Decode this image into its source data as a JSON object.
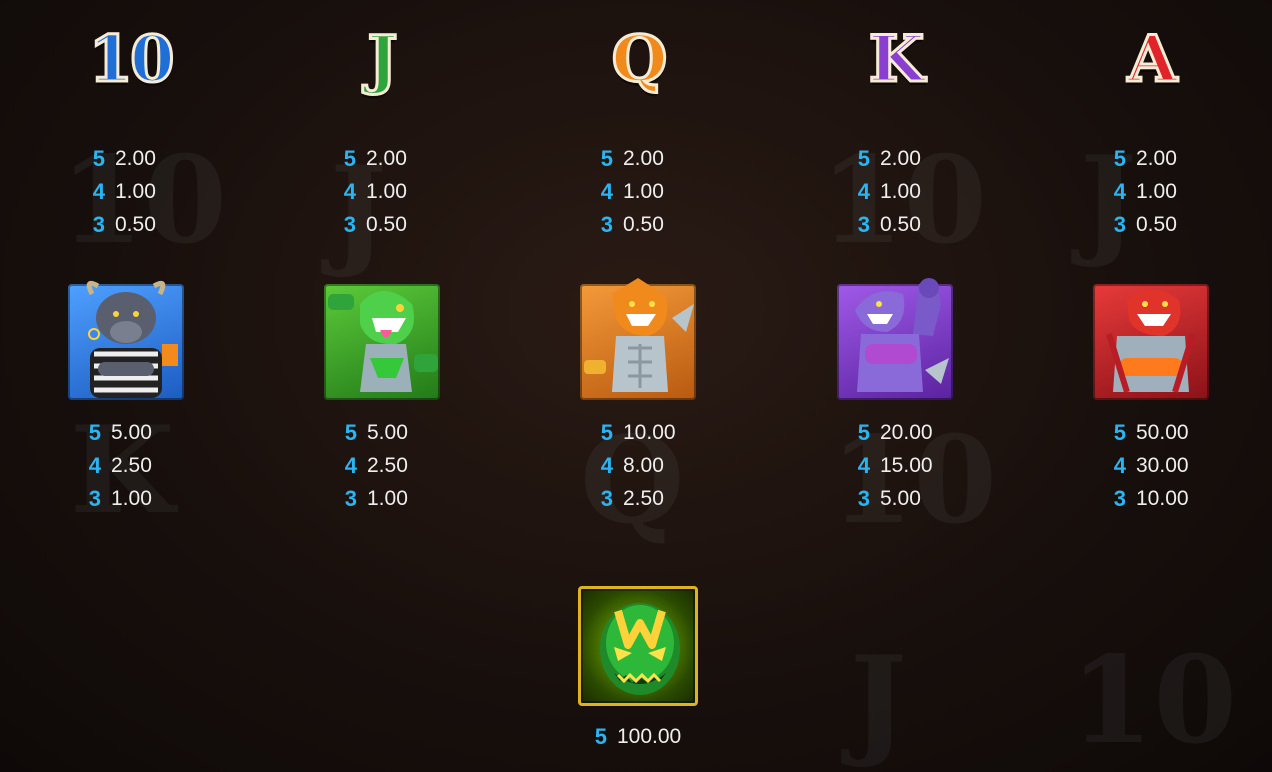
{
  "symbols": [
    {
      "name": "10",
      "type": "letter",
      "color": "#1f6fd6",
      "pays": [
        {
          "count": "5",
          "amount": "2.00"
        },
        {
          "count": "4",
          "amount": "1.00"
        },
        {
          "count": "3",
          "amount": "0.50"
        }
      ]
    },
    {
      "name": "J",
      "type": "letter",
      "color": "#2ea43a",
      "pays": [
        {
          "count": "5",
          "amount": "2.00"
        },
        {
          "count": "4",
          "amount": "1.00"
        },
        {
          "count": "3",
          "amount": "0.50"
        }
      ]
    },
    {
      "name": "Q",
      "type": "letter",
      "color": "#f08a1c",
      "pays": [
        {
          "count": "5",
          "amount": "2.00"
        },
        {
          "count": "4",
          "amount": "1.00"
        },
        {
          "count": "3",
          "amount": "0.50"
        }
      ]
    },
    {
      "name": "K",
      "type": "letter",
      "color": "#8a3fd0",
      "pays": [
        {
          "count": "5",
          "amount": "2.00"
        },
        {
          "count": "4",
          "amount": "1.00"
        },
        {
          "count": "3",
          "amount": "0.50"
        }
      ]
    },
    {
      "name": "A",
      "type": "letter",
      "color": "#e0242a",
      "pays": [
        {
          "count": "5",
          "amount": "2.00"
        },
        {
          "count": "4",
          "amount": "1.00"
        },
        {
          "count": "3",
          "amount": "0.50"
        }
      ]
    },
    {
      "name": "referee-bull",
      "type": "character",
      "color": "#2f7ad8",
      "pays": [
        {
          "count": "5",
          "amount": "5.00"
        },
        {
          "count": "4",
          "amount": "2.50"
        },
        {
          "count": "3",
          "amount": "1.00"
        }
      ]
    },
    {
      "name": "green-shark",
      "type": "character",
      "color": "#3aa02e",
      "pays": [
        {
          "count": "5",
          "amount": "5.00"
        },
        {
          "count": "4",
          "amount": "2.50"
        },
        {
          "count": "3",
          "amount": "1.00"
        }
      ]
    },
    {
      "name": "orange-shark",
      "type": "character",
      "color": "#e07a1c",
      "pays": [
        {
          "count": "5",
          "amount": "10.00"
        },
        {
          "count": "4",
          "amount": "8.00"
        },
        {
          "count": "3",
          "amount": "2.50"
        }
      ]
    },
    {
      "name": "purple-shark",
      "type": "character",
      "color": "#7c3fc8",
      "pays": [
        {
          "count": "5",
          "amount": "20.00"
        },
        {
          "count": "4",
          "amount": "15.00"
        },
        {
          "count": "3",
          "amount": "5.00"
        }
      ]
    },
    {
      "name": "red-shark",
      "type": "character",
      "color": "#c8222a",
      "pays": [
        {
          "count": "5",
          "amount": "50.00"
        },
        {
          "count": "4",
          "amount": "30.00"
        },
        {
          "count": "3",
          "amount": "10.00"
        }
      ]
    },
    {
      "name": "wild-mask",
      "type": "wild",
      "color": "#e0b21c",
      "pays": [
        {
          "count": "5",
          "amount": "100.00"
        }
      ]
    }
  ]
}
